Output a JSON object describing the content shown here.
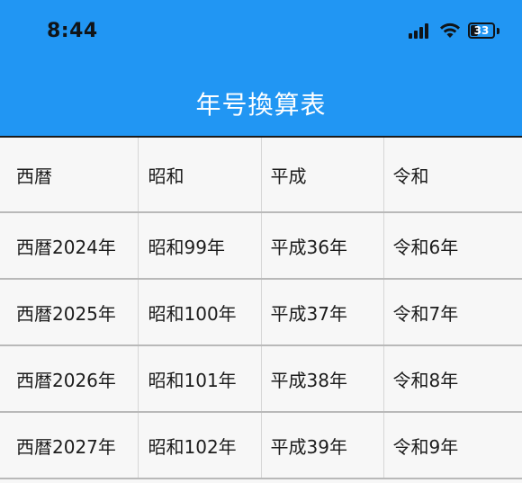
{
  "status_bar": {
    "time": "8:44",
    "battery_level": "33",
    "icons": [
      "cellular-signal-icon",
      "wifi-icon",
      "battery-icon"
    ]
  },
  "app_bar": {
    "title": "年号換算表",
    "background_color": "#2196f3"
  },
  "table": {
    "headers": [
      "西暦",
      "昭和",
      "平成",
      "令和"
    ],
    "rows": [
      [
        "西暦2024年",
        "昭和99年",
        "平成36年",
        "令和6年"
      ],
      [
        "西暦2025年",
        "昭和100年",
        "平成37年",
        "令和7年"
      ],
      [
        "西暦2026年",
        "昭和101年",
        "平成38年",
        "令和8年"
      ],
      [
        "西暦2027年",
        "昭和102年",
        "平成39年",
        "令和9年"
      ]
    ]
  }
}
